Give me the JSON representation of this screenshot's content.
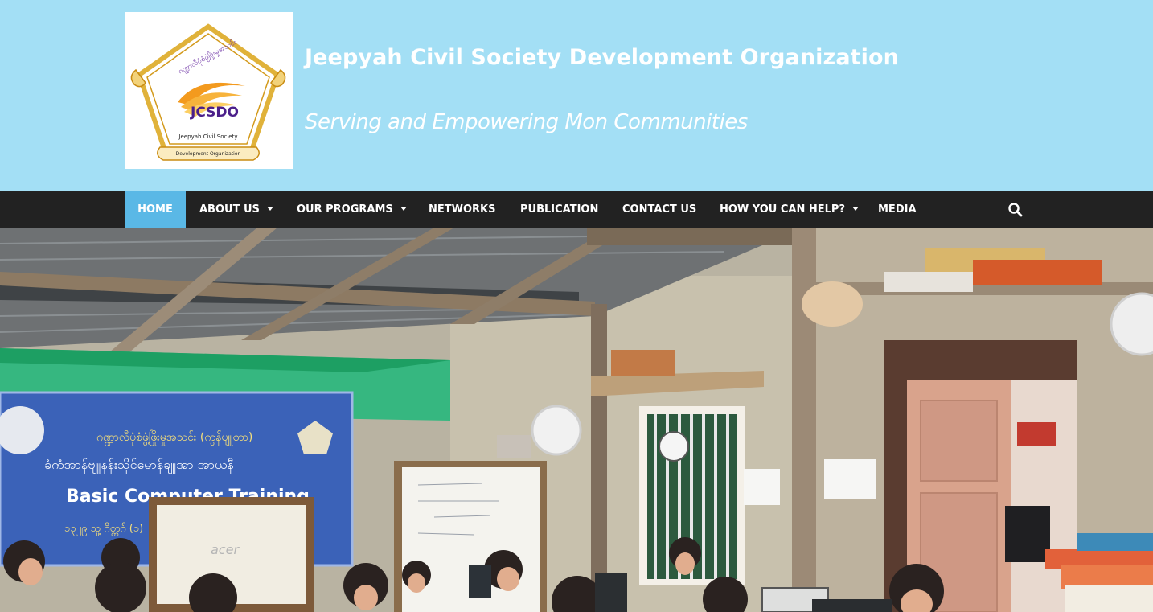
{
  "header": {
    "logo_text": {
      "circle_text": "ဂဏ္ဍာလီပုံစံဖွံ့ဖြိုးမှုအသင်း",
      "abbr": "JCSDO",
      "line1": "Jeepyah Civil Society",
      "line2": "Development Organization"
    },
    "site_title": "Jeepyah Civil Society Development Organization",
    "tagline": "Serving and Empowering Mon Communities"
  },
  "nav": {
    "items": [
      {
        "label": "HOME",
        "active": true,
        "dropdown": false
      },
      {
        "label": "ABOUT US",
        "active": false,
        "dropdown": true
      },
      {
        "label": "OUR PROGRAMS",
        "active": false,
        "dropdown": true
      },
      {
        "label": "NETWORKS",
        "active": false,
        "dropdown": false
      },
      {
        "label": "PUBLICATION",
        "active": false,
        "dropdown": false
      },
      {
        "label": "CONTACT US",
        "active": false,
        "dropdown": false
      },
      {
        "label": "HOW YOU CAN HELP?",
        "active": false,
        "dropdown": true
      },
      {
        "label": "MEDIA",
        "active": false,
        "dropdown": false
      }
    ],
    "search_icon": "search-icon",
    "active_color": "#5ab8e6",
    "bar_color": "#222222"
  },
  "hero": {
    "banner_line1": "ဂဏ္ဍာလီပုံစံဖွံ့ဖြိုးမှုအသင်း (ကွန်ပျူတာ)",
    "banner_line2": "ခံကံအာန်ဗျူနန်းသိုင်မောန်ချူအာ အာယနီ",
    "banner_heading": "Basic Computer Training",
    "banner_line3": "၁၃၂၉ သူ့ ဂိတ္တဂ် (၁)",
    "laptop_brand": "acer"
  },
  "colors": {
    "header_bg": "#a3dff5",
    "nav_bg": "#222222",
    "nav_active": "#5ab8e6"
  }
}
